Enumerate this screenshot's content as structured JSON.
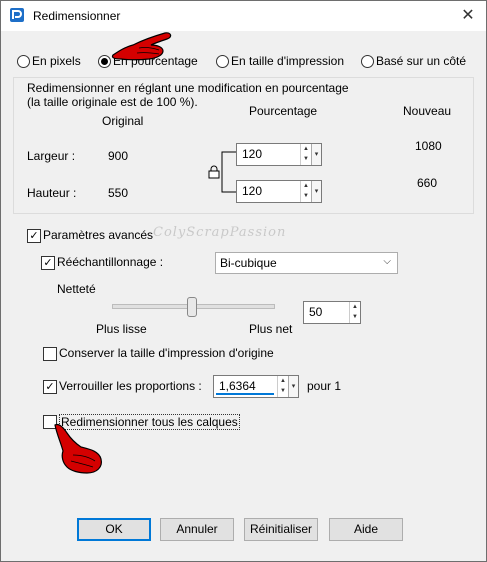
{
  "window": {
    "title": "Redimensionner",
    "close_glyph": "✕"
  },
  "mode": {
    "options": [
      "En pixels",
      "En pourcentage",
      "En taille d'impression",
      "Basé sur un côté"
    ],
    "selected": "En pourcentage"
  },
  "resize_group": {
    "description_line1": "Redimensionner en réglant une modification en pourcentage",
    "description_line2": "(la taille originale est de 100 %).",
    "col_original": "Original",
    "col_percentage": "Pourcentage",
    "col_new": "Nouveau",
    "width_label": "Largeur :",
    "height_label": "Hauteur :",
    "width_original": "900",
    "height_original": "550",
    "width_percent": "120",
    "height_percent": "120",
    "width_new": "1080",
    "height_new": "660",
    "lock_icon": "lock-icon"
  },
  "advanced": {
    "label": "Paramètres avancés",
    "checked": true,
    "resample_label": "Rééchantillonnage :",
    "resample_checked": true,
    "resample_value": "Bi-cubique",
    "sharpness_label": "Netteté",
    "sharpness_min_label": "Plus lisse",
    "sharpness_max_label": "Plus net",
    "sharpness_value": "50",
    "sharpness_level": 50,
    "keep_print_size_label": "Conserver la taille d'impression d'origine",
    "keep_print_size_checked": false,
    "lock_ratio_label": "Verrouiller les proportions :",
    "lock_ratio_checked": true,
    "ratio_value": "1,6364",
    "ratio_suffix": "pour 1",
    "resize_all_layers_label": "Redimensionner tous les calques",
    "resize_all_layers_checked": false
  },
  "watermark": "ColyScrapPassion",
  "buttons": {
    "ok": "OK",
    "cancel": "Annuler",
    "reset": "Réinitialiser",
    "help": "Aide"
  },
  "colors": {
    "accent": "#0078d7",
    "pointer_hand": "#d40000"
  }
}
